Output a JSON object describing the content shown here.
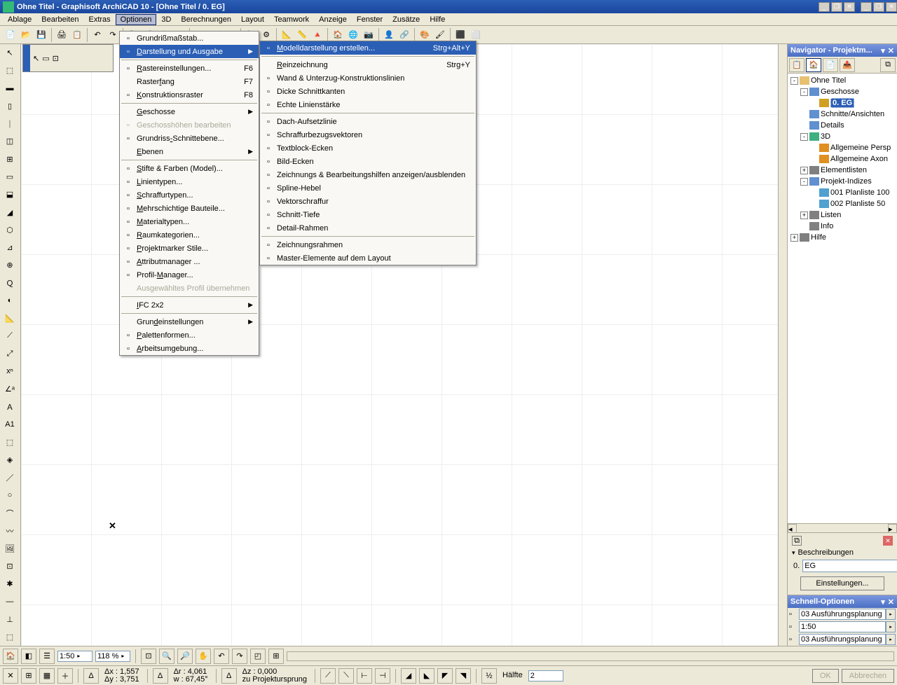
{
  "titlebar": {
    "title": "Ohne Titel - Graphisoft ArchiCAD 10 - [Ohne Titel / 0. EG]"
  },
  "menubar": {
    "items": [
      "Ablage",
      "Bearbeiten",
      "Extras",
      "Optionen",
      "3D",
      "Berechnungen",
      "Layout",
      "Teamwork",
      "Anzeige",
      "Fenster",
      "Zusätze",
      "Hilfe"
    ],
    "active_index": 3
  },
  "menu1": {
    "items": [
      {
        "label": "Grundrißmaßstab...",
        "icon": "scale-icon"
      },
      {
        "label": "Darstellung und Ausgabe",
        "icon": "display-icon",
        "highlight": true,
        "arrow": true,
        "u": 0
      },
      {
        "sep": true
      },
      {
        "label": "Rastereinstellungen...",
        "icon": "grid-icon",
        "shortcut": "F6",
        "u": 0
      },
      {
        "label": "Rasterfang",
        "shortcut": "F7",
        "u": 6
      },
      {
        "label": "Konstruktionsraster",
        "icon": "constr-grid-icon",
        "shortcut": "F8",
        "u": 0
      },
      {
        "sep": true
      },
      {
        "label": "Geschosse",
        "arrow": true,
        "u": 0
      },
      {
        "label": "Geschosshöhen bearbeiten",
        "icon": "story-icon",
        "disabled": true
      },
      {
        "label": "Grundriss-Schnittebene...",
        "icon": "section-icon",
        "u": 9
      },
      {
        "label": "Ebenen",
        "arrow": true,
        "u": 0
      },
      {
        "sep": true
      },
      {
        "label": "Stifte & Farben (Model)...",
        "icon": "pen-icon",
        "u": 0
      },
      {
        "label": "Linientypen...",
        "icon": "line-icon",
        "u": 0
      },
      {
        "label": "Schraffurtypen...",
        "icon": "hatch-icon",
        "u": 0
      },
      {
        "label": "Mehrschichtige Bauteile...",
        "icon": "composite-icon",
        "u": 0
      },
      {
        "label": "Materialtypen...",
        "icon": "material-icon",
        "u": 0
      },
      {
        "label": "Raumkategorien...",
        "icon": "zone-icon",
        "u": 0
      },
      {
        "label": "Projektmarker Stile...",
        "icon": "marker-icon",
        "u": 0
      },
      {
        "label": "Attributmanager ...",
        "icon": "attrib-icon",
        "u": 0
      },
      {
        "label": "Profil-Manager...",
        "icon": "profile-icon",
        "u": 7
      },
      {
        "label": "Ausgewähltes Profil übernehmen",
        "disabled": true
      },
      {
        "sep": true
      },
      {
        "label": "IFC 2x2",
        "arrow": true,
        "u": 0
      },
      {
        "sep": true
      },
      {
        "label": "Grundeinstellungen",
        "arrow": true,
        "u": 4
      },
      {
        "label": "Palettenformen...",
        "icon": "palette-icon",
        "u": 0
      },
      {
        "label": "Arbeitsumgebung...",
        "icon": "workenv-icon",
        "u": 0
      }
    ]
  },
  "menu2": {
    "items": [
      {
        "label": "Modelldarstellung erstellen...",
        "icon": "model-icon",
        "shortcut": "Strg+Alt+Y",
        "highlight": true,
        "u": 0
      },
      {
        "sep": true
      },
      {
        "label": "Reinzeichnung",
        "shortcut": "Strg+Y",
        "u": 0
      },
      {
        "label": "Wand & Unterzug-Konstruktionslinien",
        "icon": "wall-icon"
      },
      {
        "label": "Dicke Schnittkanten",
        "icon": "thick-icon"
      },
      {
        "label": "Echte Linienstärke",
        "icon": "trueline-icon"
      },
      {
        "sep": true
      },
      {
        "label": "Dach-Aufsetzlinie",
        "icon": "roof-icon"
      },
      {
        "label": "Schraffurbezugsvektoren",
        "icon": "hatchvec-icon"
      },
      {
        "label": "Textblock-Ecken",
        "icon": "textcorner-icon"
      },
      {
        "label": "Bild-Ecken",
        "icon": "imgcorner-icon"
      },
      {
        "label": "Zeichnungs & Bearbeitungshilfen anzeigen/ausblenden",
        "icon": "drawaid-icon"
      },
      {
        "label": "Spline-Hebel",
        "icon": "spline-icon"
      },
      {
        "label": "Vektorschraffur",
        "icon": "vecfill-icon"
      },
      {
        "label": "Schnitt-Tiefe",
        "icon": "sectdepth-icon"
      },
      {
        "label": "Detail-Rahmen",
        "icon": "detail-icon"
      },
      {
        "sep": true
      },
      {
        "label": "Zeichnungsrahmen",
        "icon": "drawframe-icon"
      },
      {
        "label": "Master-Elemente auf dem Layout",
        "icon": "master-icon"
      }
    ]
  },
  "navigator": {
    "title": "Navigator - Projektm...",
    "tree": [
      {
        "ind": 0,
        "exp": "-",
        "icon": "#e8c070",
        "label": "Ohne Titel"
      },
      {
        "ind": 1,
        "exp": "-",
        "icon": "#6090d0",
        "label": "Geschosse"
      },
      {
        "ind": 2,
        "exp": "",
        "icon": "#d0a020",
        "label": "0. EG",
        "sel": true
      },
      {
        "ind": 1,
        "exp": "",
        "icon": "#6090d0",
        "label": "Schnitte/Ansichten"
      },
      {
        "ind": 1,
        "exp": "",
        "icon": "#6090d0",
        "label": "Details"
      },
      {
        "ind": 1,
        "exp": "-",
        "icon": "#40b080",
        "label": "3D"
      },
      {
        "ind": 2,
        "exp": "",
        "icon": "#e09020",
        "label": "Allgemeine Persp"
      },
      {
        "ind": 2,
        "exp": "",
        "icon": "#e09020",
        "label": "Allgemeine Axon"
      },
      {
        "ind": 1,
        "exp": "+",
        "icon": "#808080",
        "label": "Elementlisten"
      },
      {
        "ind": 1,
        "exp": "-",
        "icon": "#6090d0",
        "label": "Projekt-Indizes"
      },
      {
        "ind": 2,
        "exp": "",
        "icon": "#50a0d0",
        "label": "001 Planliste 100"
      },
      {
        "ind": 2,
        "exp": "",
        "icon": "#50a0d0",
        "label": "002 Planliste 50"
      },
      {
        "ind": 1,
        "exp": "+",
        "icon": "#808080",
        "label": "Listen"
      },
      {
        "ind": 1,
        "exp": "",
        "icon": "#808080",
        "label": "Info"
      },
      {
        "ind": 0,
        "exp": "+",
        "icon": "#808080",
        "label": "Hilfe"
      }
    ]
  },
  "desc": {
    "header": "Beschreibungen",
    "num": "0.",
    "name": "EG",
    "btn": "Einstellungen..."
  },
  "quickopt": {
    "title": "Schnell-Optionen",
    "rows": [
      "03 Ausführungsplanung",
      "1:50",
      "03 Ausführungsplanung"
    ]
  },
  "status1": {
    "scale": "1:50",
    "zoom": "118 %"
  },
  "status2": {
    "dx": "1,557",
    "dy": "3,751",
    "dr": "4,061",
    "dw": "67,45°",
    "dz": "0,000",
    "origin": "zu Projektursprung",
    "half": "Hälfte",
    "half_val": "2",
    "ok": "OK",
    "cancel": "Abbrechen"
  }
}
